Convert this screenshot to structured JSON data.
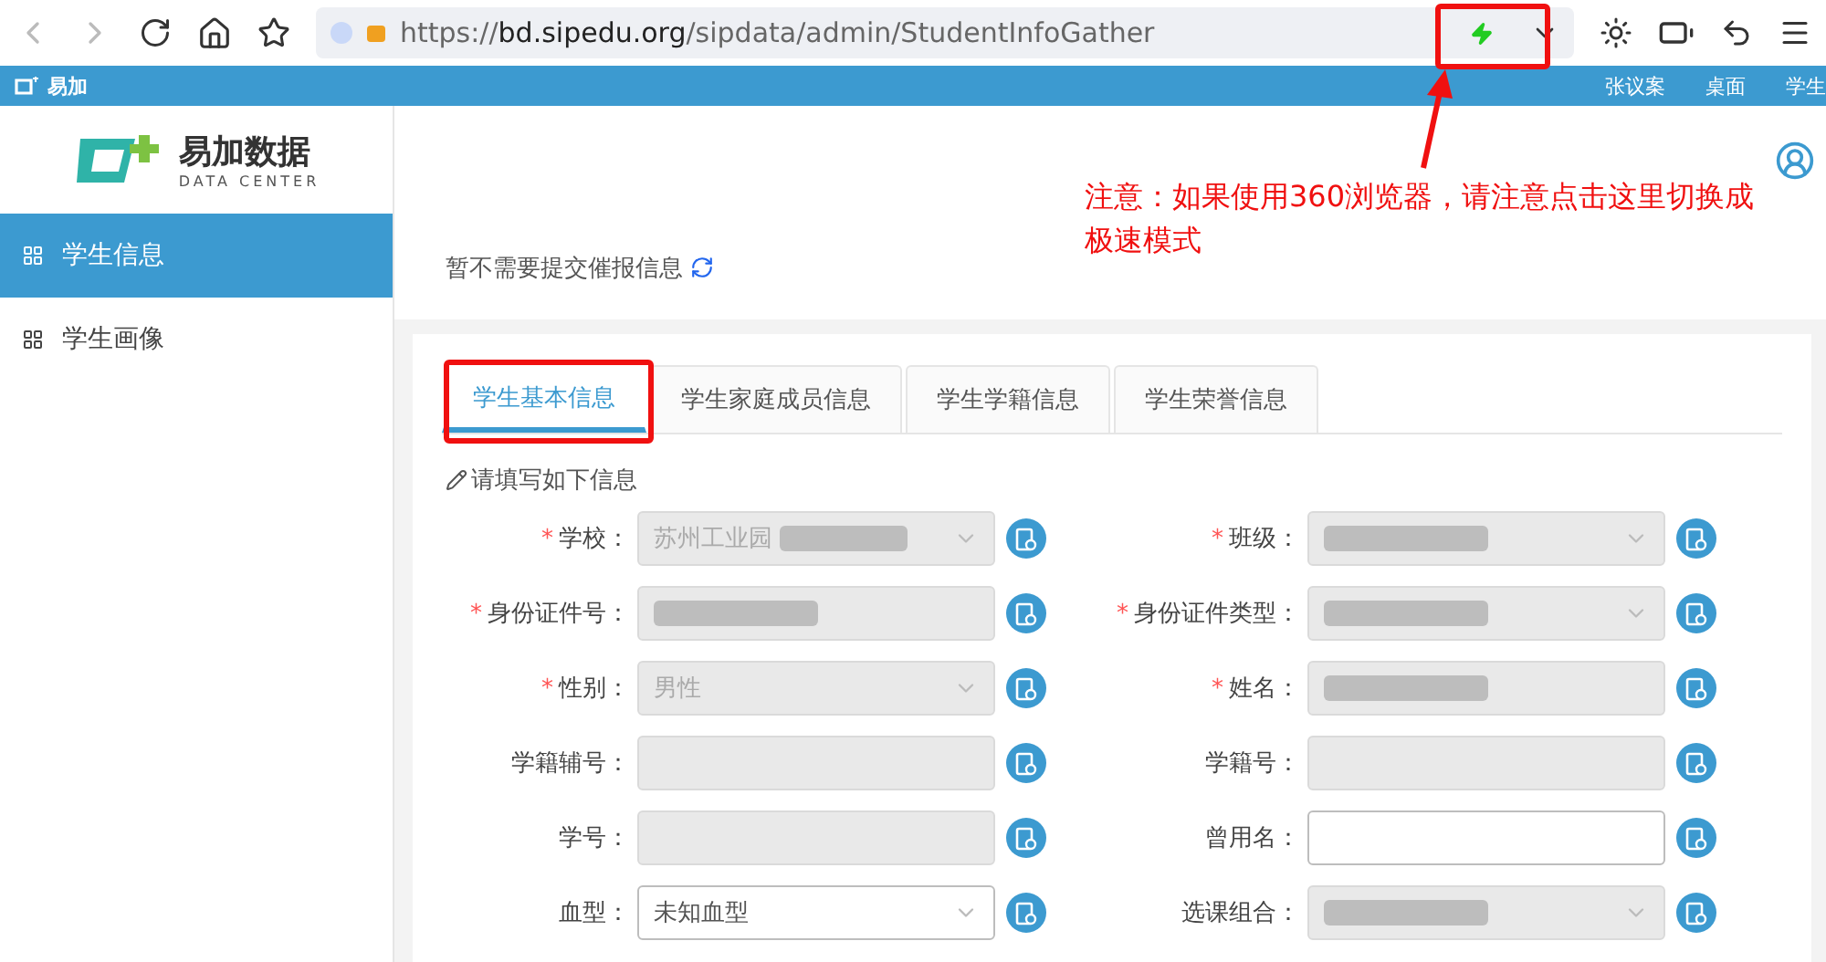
{
  "browser": {
    "url": "https://**bd.sipedu.org**/sipdata/admin/StudentInfoGather"
  },
  "topbar": {
    "brand": "易加",
    "links": [
      "张议案",
      "桌面",
      "学生"
    ]
  },
  "logo": {
    "title": "易加数据",
    "subtitle": "DATA CENTER"
  },
  "sidebar": {
    "items": [
      {
        "label": "学生信息",
        "selected": true
      },
      {
        "label": "学生画像",
        "selected": false
      }
    ]
  },
  "notice": {
    "text": "暂不需要提交催报信息"
  },
  "tabs": [
    {
      "label": "学生基本信息",
      "selected": true
    },
    {
      "label": "学生家庭成员信息",
      "selected": false
    },
    {
      "label": "学生学籍信息",
      "selected": false
    },
    {
      "label": "学生荣誉信息",
      "selected": false
    }
  ],
  "form": {
    "hint": "请填写如下信息",
    "fields": [
      {
        "label": "学校：",
        "mark": "*",
        "kind": "select",
        "disabled": true,
        "value": "苏州工业园",
        "blurred": true
      },
      {
        "label": "班级：",
        "mark": "*",
        "kind": "select",
        "disabled": true,
        "blurred": true
      },
      {
        "label": "身份证件号：",
        "mark": "*",
        "kind": "input",
        "disabled": true,
        "blurred": true
      },
      {
        "label": "身份证件类型：",
        "mark": "*",
        "kind": "select",
        "disabled": true,
        "blurred": true
      },
      {
        "label": "性别：",
        "mark": "*",
        "kind": "select",
        "disabled": true,
        "value": "男性",
        "blurred": false
      },
      {
        "label": "姓名：",
        "mark": "*",
        "kind": "input",
        "disabled": true,
        "blurred": true
      },
      {
        "label": "学籍辅号：",
        "kind": "input",
        "disabled": true,
        "blurred": false
      },
      {
        "label": "学籍号：",
        "kind": "input",
        "disabled": true,
        "blurred": false
      },
      {
        "label": "学号：",
        "kind": "input",
        "disabled": true,
        "blurred": false
      },
      {
        "label": "曾用名：",
        "kind": "input",
        "disabled": false,
        "blurred": false
      },
      {
        "label": "血型：",
        "kind": "select",
        "disabled": false,
        "value": "未知血型",
        "blurred": false
      },
      {
        "label": "选课组合：",
        "kind": "select",
        "disabled": true,
        "blurred": true
      }
    ]
  },
  "annotation": {
    "text": "注意：如果使用360浏览器，请注意点击这里切换成极速模式"
  }
}
